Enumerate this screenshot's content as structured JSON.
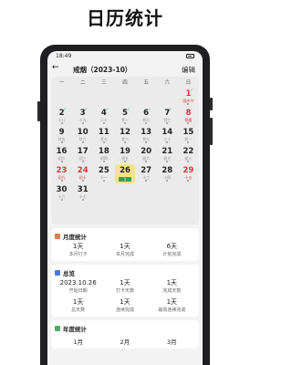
{
  "headline": "日历统计",
  "status": {
    "time": "18:49"
  },
  "topbar": {
    "back": "←",
    "title": "戒烟（2023-10）",
    "edit": "编辑"
  },
  "weekdays": [
    "一",
    "二",
    "三",
    "四",
    "五",
    "六",
    "日"
  ],
  "days": [
    {
      "d": "",
      "s": ""
    },
    {
      "d": "",
      "s": ""
    },
    {
      "d": "",
      "s": ""
    },
    {
      "d": "",
      "s": ""
    },
    {
      "d": "",
      "s": ""
    },
    {
      "d": "",
      "s": ""
    },
    {
      "d": "1",
      "s": "国庆节",
      "red": true,
      "mk": "✓"
    },
    {
      "d": "2",
      "s": "十八",
      "mk": "✓"
    },
    {
      "d": "3",
      "s": "十九",
      "mk": "✓"
    },
    {
      "d": "4",
      "s": "二十",
      "mk": "✓"
    },
    {
      "d": "5",
      "s": "廿一",
      "mk": "✓"
    },
    {
      "d": "6",
      "s": "廿二",
      "mk": "✓"
    },
    {
      "d": "7",
      "s": "廿三",
      "mk": "✓"
    },
    {
      "d": "8",
      "s": "寒露",
      "red": true
    },
    {
      "d": "9",
      "s": "廿五"
    },
    {
      "d": "10",
      "s": "廿六"
    },
    {
      "d": "11",
      "s": "廿七"
    },
    {
      "d": "12",
      "s": "廿八"
    },
    {
      "d": "13",
      "s": "廿九"
    },
    {
      "d": "14",
      "s": "三十"
    },
    {
      "d": "15",
      "s": "初一"
    },
    {
      "d": "16",
      "s": "初二"
    },
    {
      "d": "17",
      "s": "初三"
    },
    {
      "d": "18",
      "s": "初四"
    },
    {
      "d": "19",
      "s": "初五"
    },
    {
      "d": "20",
      "s": "初六"
    },
    {
      "d": "21",
      "s": "初七"
    },
    {
      "d": "22",
      "s": "初八"
    },
    {
      "d": "23",
      "s": "初九",
      "red": true
    },
    {
      "d": "24",
      "s": "初十",
      "red": true
    },
    {
      "d": "25",
      "s": "十一"
    },
    {
      "d": "26",
      "s": "1",
      "sel": true
    },
    {
      "d": "27",
      "s": "十三"
    },
    {
      "d": "28",
      "s": "十四"
    },
    {
      "d": "29",
      "s": "十五",
      "red": true
    },
    {
      "d": "30",
      "s": "十六"
    },
    {
      "d": "31",
      "s": "十七"
    }
  ],
  "monthly": {
    "title": "月度统计",
    "items": [
      {
        "v": "1天",
        "l": "本月打卡"
      },
      {
        "v": "1天",
        "l": "本月完成"
      },
      {
        "v": "6天",
        "l": "计划完成"
      }
    ]
  },
  "total": {
    "title": "总览",
    "row1": [
      {
        "v": "2023.10.26",
        "l": "开始日期"
      },
      {
        "v": "1天",
        "l": "打卡天数"
      },
      {
        "v": "1天",
        "l": "完成天数"
      }
    ],
    "row2": [
      {
        "v": "1天",
        "l": "总天数"
      },
      {
        "v": "1天",
        "l": "连续完成"
      },
      {
        "v": "1天",
        "l": "最高连续完成"
      }
    ]
  },
  "yearly": {
    "title": "年度统计",
    "months": [
      "1月",
      "2月",
      "3月"
    ]
  }
}
